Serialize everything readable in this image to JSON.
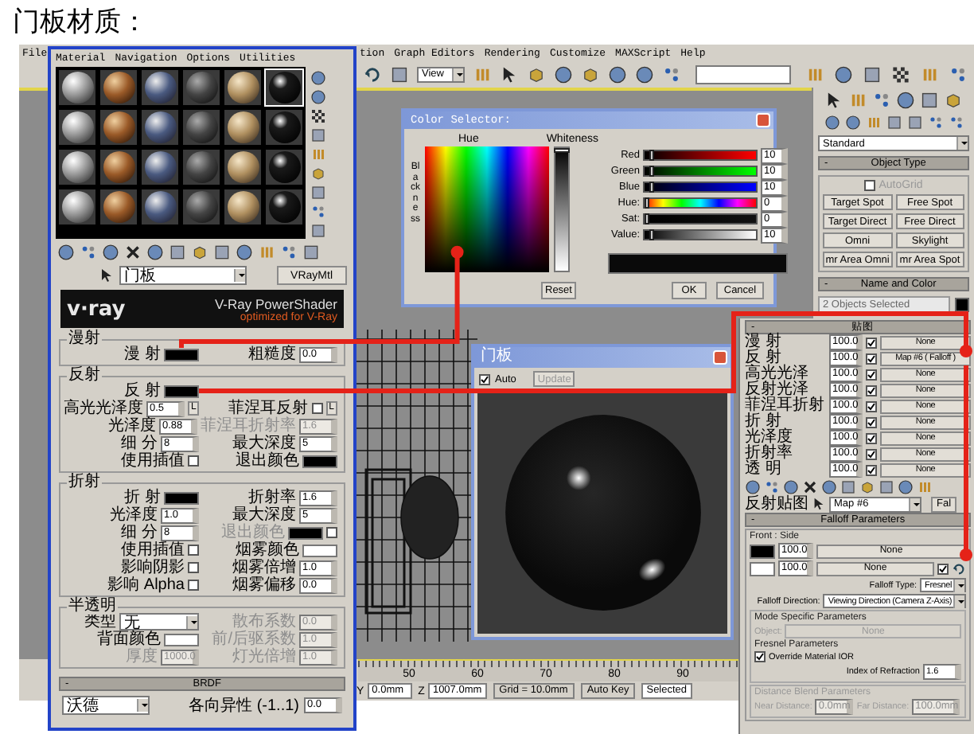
{
  "heading": "门板材质：",
  "main_menu": {
    "left": [
      "File"
    ],
    "right": [
      "tion",
      "Graph Editors",
      "Rendering",
      "Customize",
      "MAXScript",
      "Help"
    ]
  },
  "main_toolbar": {
    "view_dropdown": "View"
  },
  "command_panel": {
    "category": "Standard",
    "object_type": {
      "sign": "-",
      "title": "Object Type",
      "autogrid": {
        "label": "AutoGrid",
        "checked": false
      },
      "buttons": [
        "Target Spot",
        "Free Spot",
        "Target Direct",
        "Free Direct",
        "Omni",
        "Skylight",
        "mr Area Omni",
        "mr Area Spot"
      ]
    },
    "name_and_color": {
      "sign": "-",
      "title": "Name and Color",
      "value": "2 Objects Selected",
      "color": "#000000"
    }
  },
  "status_bar": {
    "ruler": [
      "50",
      "60",
      "70",
      "80",
      "90"
    ],
    "coords": [
      {
        "label": "Y",
        "value": "0.0mm"
      },
      {
        "label": "Z",
        "value": "1007.0mm"
      }
    ],
    "grid": "Grid = 10.0mm",
    "auto_key": "Auto Key",
    "selection": "Selected"
  },
  "material_editor": {
    "menu": [
      "Material",
      "Navigation",
      "Options",
      "Utilities"
    ],
    "slots": [
      {
        "selected": false
      },
      {
        "selected": false
      },
      {
        "selected": false
      },
      {
        "selected": false
      },
      {
        "selected": false
      },
      {
        "selected": true
      },
      {
        "selected": false
      },
      {
        "selected": false
      },
      {
        "selected": false
      },
      {
        "selected": false
      },
      {
        "selected": false
      },
      {
        "selected": false
      },
      {
        "selected": false
      },
      {
        "selected": false
      },
      {
        "selected": false
      },
      {
        "selected": false
      },
      {
        "selected": false
      },
      {
        "selected": false
      },
      {
        "selected": false
      },
      {
        "selected": false
      },
      {
        "selected": false
      },
      {
        "selected": false
      },
      {
        "selected": false
      },
      {
        "selected": false
      }
    ],
    "name": "门板",
    "type_button": "VRayMtl",
    "banner": {
      "logo": "v·ray",
      "title": "V-Ray PowerShader",
      "subtitle": "optimized for V-Ray"
    },
    "sections": [
      {
        "title": "漫射",
        "rows": [
          {
            "left": [
              {
                "kind": "label",
                "text": "漫 射"
              },
              {
                "kind": "swatch",
                "color": "#000000"
              }
            ],
            "right": [
              {
                "kind": "label",
                "text": "粗糙度"
              },
              {
                "kind": "field",
                "value": "0.0"
              }
            ]
          }
        ]
      },
      {
        "title": "反射",
        "rows": [
          {
            "left": [
              {
                "kind": "label",
                "text": "反 射"
              },
              {
                "kind": "swatch",
                "color": "#000000"
              }
            ],
            "right": []
          },
          {
            "left": [
              {
                "kind": "label",
                "text": "高光光泽度"
              },
              {
                "kind": "field",
                "value": "0.5"
              },
              {
                "kind": "button",
                "text": "L"
              }
            ],
            "right": [
              {
                "kind": "label",
                "text": "菲涅耳反射"
              },
              {
                "kind": "check",
                "checked": false
              },
              {
                "kind": "button",
                "text": "L"
              }
            ]
          },
          {
            "left": [
              {
                "kind": "label",
                "text": "光泽度"
              },
              {
                "kind": "field",
                "value": "0.88"
              }
            ],
            "right": [
              {
                "kind": "label",
                "text": "菲涅耳折射率",
                "disabled": true
              },
              {
                "kind": "field",
                "value": "1.6",
                "disabled": true
              }
            ]
          },
          {
            "left": [
              {
                "kind": "label",
                "text": "细 分"
              },
              {
                "kind": "field",
                "value": "8"
              }
            ],
            "right": [
              {
                "kind": "label",
                "text": "最大深度"
              },
              {
                "kind": "field",
                "value": "5"
              }
            ]
          },
          {
            "left": [
              {
                "kind": "label",
                "text": "使用插值"
              },
              {
                "kind": "check",
                "checked": false
              }
            ],
            "right": [
              {
                "kind": "label",
                "text": "退出颜色"
              },
              {
                "kind": "swatch",
                "color": "#000000"
              }
            ]
          }
        ]
      },
      {
        "title": "折射",
        "rows": [
          {
            "left": [
              {
                "kind": "label",
                "text": "折 射"
              },
              {
                "kind": "swatch",
                "color": "#000000"
              }
            ],
            "right": [
              {
                "kind": "label",
                "text": "折射率"
              },
              {
                "kind": "field",
                "value": "1.6"
              }
            ]
          },
          {
            "left": [
              {
                "kind": "label",
                "text": "光泽度"
              },
              {
                "kind": "field",
                "value": "1.0"
              }
            ],
            "right": [
              {
                "kind": "label",
                "text": "最大深度"
              },
              {
                "kind": "field",
                "value": "5"
              }
            ]
          },
          {
            "left": [
              {
                "kind": "label",
                "text": "细 分"
              },
              {
                "kind": "field",
                "value": "8"
              }
            ],
            "right": [
              {
                "kind": "label",
                "text": "退出颜色",
                "disabled": true
              },
              {
                "kind": "swatch",
                "color": "#000000"
              },
              {
                "kind": "check",
                "checked": false
              }
            ]
          },
          {
            "left": [
              {
                "kind": "label",
                "text": "使用插值"
              },
              {
                "kind": "check",
                "checked": false
              }
            ],
            "right": [
              {
                "kind": "label",
                "text": "烟雾颜色"
              },
              {
                "kind": "swatch",
                "color": "#ffffff"
              }
            ]
          },
          {
            "left": [
              {
                "kind": "label",
                "text": "影响阴影"
              },
              {
                "kind": "check",
                "checked": false
              }
            ],
            "right": [
              {
                "kind": "label",
                "text": "烟雾倍增"
              },
              {
                "kind": "field",
                "value": "1.0"
              }
            ]
          },
          {
            "left": [
              {
                "kind": "label",
                "text": "影响 Alpha"
              },
              {
                "kind": "check",
                "checked": false
              }
            ],
            "right": [
              {
                "kind": "label",
                "text": "烟雾偏移"
              },
              {
                "kind": "field",
                "value": "0.0"
              }
            ]
          }
        ]
      },
      {
        "title": "半透明",
        "rows": [
          {
            "left": [
              {
                "kind": "label",
                "text": "类型"
              },
              {
                "kind": "dropdown",
                "value": "无"
              }
            ],
            "right": [
              {
                "kind": "label",
                "text": "散布系数",
                "disabled": true
              },
              {
                "kind": "field",
                "value": "0.0",
                "disabled": true
              }
            ]
          },
          {
            "left": [
              {
                "kind": "label",
                "text": "背面颜色"
              },
              {
                "kind": "swatch",
                "color": "#ffffff"
              }
            ],
            "right": [
              {
                "kind": "label",
                "text": "前/后驱系数",
                "disabled": true
              },
              {
                "kind": "field",
                "value": "1.0",
                "disabled": true
              }
            ]
          },
          {
            "left": [
              {
                "kind": "label",
                "text": "厚度",
                "disabled": true
              },
              {
                "kind": "field",
                "value": "1000.0",
                "disabled": true
              }
            ],
            "right": [
              {
                "kind": "label",
                "text": "灯光倍增",
                "disabled": true
              },
              {
                "kind": "field",
                "value": "1.0",
                "disabled": true
              }
            ]
          }
        ]
      }
    ],
    "brdf": {
      "sign": "-",
      "title": "BRDF",
      "type": "沃德",
      "anisotropy_label": "各向异性 (-1..1)",
      "anisotropy": "0.0"
    }
  },
  "color_selector": {
    "title": "Color Selector:",
    "hue_label": "Hue",
    "whiteness": {
      "label": "Whiteness",
      "level": 0
    },
    "blackness_label": "Blackness",
    "channels": [
      {
        "kind": "red",
        "name": "Red",
        "level": 0.04,
        "value": "10"
      },
      {
        "kind": "green",
        "name": "Green",
        "level": 0.04,
        "value": "10"
      },
      {
        "kind": "blue",
        "name": "Blue",
        "level": 0.04,
        "value": "10"
      },
      {
        "kind": "hue",
        "name": "Hue:",
        "level": 0,
        "value": "0"
      },
      {
        "kind": "sat",
        "name": "Sat:",
        "level": 0,
        "value": "0"
      },
      {
        "kind": "value",
        "name": "Value:",
        "level": 0.04,
        "value": "10"
      }
    ],
    "color": "#0a0a0a",
    "reset": "Reset",
    "ok": "OK",
    "cancel": "Cancel"
  },
  "preview": {
    "title": "门板",
    "auto": {
      "label": "Auto",
      "checked": true
    },
    "update": {
      "label": "Update",
      "disabled": true
    }
  },
  "maps": {
    "sign": "-",
    "title": "贴图",
    "rows": [
      {
        "label": "漫 射",
        "amount": "100.0",
        "checked": true,
        "map": "None"
      },
      {
        "label": "反 射",
        "amount": "100.0",
        "checked": true,
        "map": "Map #6  ( Falloff )"
      },
      {
        "label": "高光光泽",
        "amount": "100.0",
        "checked": true,
        "map": "None"
      },
      {
        "label": "反射光泽",
        "amount": "100.0",
        "checked": true,
        "map": "None"
      },
      {
        "label": "菲涅耳折射",
        "amount": "100.0",
        "checked": true,
        "map": "None"
      },
      {
        "label": "折 射",
        "amount": "100.0",
        "checked": true,
        "map": "None"
      },
      {
        "label": "光泽度",
        "amount": "100.0",
        "checked": true,
        "map": "None"
      },
      {
        "label": "折射率",
        "amount": "100.0",
        "checked": true,
        "map": "None"
      },
      {
        "label": "透 明",
        "amount": "100.0",
        "checked": true,
        "map": "None"
      }
    ],
    "map_label": "反射贴图",
    "map_name": "Map #6",
    "type_button": "Fal"
  },
  "falloff": {
    "sign": "-",
    "title": "Falloff Parameters",
    "front_side_label": "Front : Side",
    "slots": [
      {
        "color": "#000000",
        "amount": "100.0",
        "map": "None"
      },
      {
        "color": "#ffffff",
        "amount": "100.0",
        "map": "None",
        "checked": true
      }
    ],
    "type_label": "Falloff Type:",
    "type": "Fresnel",
    "direction_label": "Falloff Direction:",
    "direction": "Viewing Direction (Camera Z-Axis)",
    "mode_title": "Mode Specific Parameters",
    "object_label": "Object:",
    "object_value": "None",
    "fresnel_title": "Fresnel Parameters",
    "override": {
      "label": "Override Material IOR",
      "checked": true
    },
    "ior_label": "Index of Refraction",
    "ior": "1.6",
    "distance_title": "Distance Blend Parameters",
    "near_label": "Near Distance:",
    "near": "0.0mm",
    "far_label": "Far Distance:",
    "far": "100.0mm"
  }
}
